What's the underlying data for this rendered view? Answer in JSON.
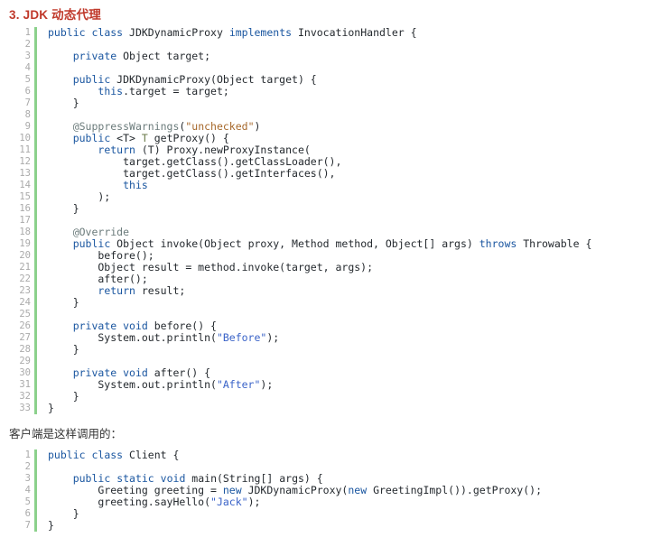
{
  "document": {
    "heading": "3. JDK 动态代理",
    "paragraph": "客户端是这样调用的：",
    "accent_colors": {
      "heading": "#c0392b",
      "gutter_rail": "#8cd18c",
      "line_number": "#aaaaaa",
      "keyword": "#1a56a0",
      "string": "#3a63c8",
      "string_alt": "#a6682b",
      "annotation": "#6b7b7b",
      "plain": "#24292e"
    }
  },
  "code_blocks": [
    {
      "name": "jdk-dynamic-proxy",
      "language": "java",
      "first_line": 1,
      "lines": [
        [
          {
            "t": "kw",
            "v": "public"
          },
          {
            "t": "pln",
            "v": " "
          },
          {
            "t": "kw",
            "v": "class"
          },
          {
            "t": "pln",
            "v": " JDKDynamicProxy "
          },
          {
            "t": "kw",
            "v": "implements"
          },
          {
            "t": "pln",
            "v": " InvocationHandler {"
          }
        ],
        [],
        [
          {
            "t": "pln",
            "v": "    "
          },
          {
            "t": "kw",
            "v": "private"
          },
          {
            "t": "pln",
            "v": " Object target;"
          }
        ],
        [],
        [
          {
            "t": "pln",
            "v": "    "
          },
          {
            "t": "kw",
            "v": "public"
          },
          {
            "t": "pln",
            "v": " JDKDynamicProxy(Object target) {"
          }
        ],
        [
          {
            "t": "pln",
            "v": "        "
          },
          {
            "t": "kw",
            "v": "this"
          },
          {
            "t": "pln",
            "v": ".target = target;"
          }
        ],
        [
          {
            "t": "pln",
            "v": "    }"
          }
        ],
        [],
        [
          {
            "t": "pln",
            "v": "    "
          },
          {
            "t": "ann",
            "v": "@SuppressWarnings"
          },
          {
            "t": "pln",
            "v": "("
          },
          {
            "t": "str-orange",
            "v": "\"unchecked\""
          },
          {
            "t": "pln",
            "v": ")"
          }
        ],
        [
          {
            "t": "pln",
            "v": "    "
          },
          {
            "t": "kw",
            "v": "public"
          },
          {
            "t": "pln",
            "v": " <T> "
          },
          {
            "t": "typ",
            "v": "T"
          },
          {
            "t": "pln",
            "v": " getProxy() {"
          }
        ],
        [
          {
            "t": "pln",
            "v": "        "
          },
          {
            "t": "kw",
            "v": "return"
          },
          {
            "t": "pln",
            "v": " (T) Proxy.newProxyInstance("
          }
        ],
        [
          {
            "t": "pln",
            "v": "            target.getClass().getClassLoader(),"
          }
        ],
        [
          {
            "t": "pln",
            "v": "            target.getClass().getInterfaces(),"
          }
        ],
        [
          {
            "t": "pln",
            "v": "            "
          },
          {
            "t": "kw",
            "v": "this"
          }
        ],
        [
          {
            "t": "pln",
            "v": "        );"
          }
        ],
        [
          {
            "t": "pln",
            "v": "    }"
          }
        ],
        [],
        [
          {
            "t": "pln",
            "v": "    "
          },
          {
            "t": "ann",
            "v": "@Override"
          }
        ],
        [
          {
            "t": "pln",
            "v": "    "
          },
          {
            "t": "kw",
            "v": "public"
          },
          {
            "t": "pln",
            "v": " Object invoke(Object proxy, Method method, Object[] args) "
          },
          {
            "t": "kw",
            "v": "throws"
          },
          {
            "t": "pln",
            "v": " Throwable {"
          }
        ],
        [
          {
            "t": "pln",
            "v": "        before();"
          }
        ],
        [
          {
            "t": "pln",
            "v": "        Object result = method.invoke(target, args);"
          }
        ],
        [
          {
            "t": "pln",
            "v": "        after();"
          }
        ],
        [
          {
            "t": "pln",
            "v": "        "
          },
          {
            "t": "kw",
            "v": "return"
          },
          {
            "t": "pln",
            "v": " result;"
          }
        ],
        [
          {
            "t": "pln",
            "v": "    }"
          }
        ],
        [],
        [
          {
            "t": "pln",
            "v": "    "
          },
          {
            "t": "kw",
            "v": "private"
          },
          {
            "t": "pln",
            "v": " "
          },
          {
            "t": "kw",
            "v": "void"
          },
          {
            "t": "pln",
            "v": " before() {"
          }
        ],
        [
          {
            "t": "pln",
            "v": "        System.out.println("
          },
          {
            "t": "str",
            "v": "\"Before\""
          },
          {
            "t": "pln",
            "v": ");"
          }
        ],
        [
          {
            "t": "pln",
            "v": "    }"
          }
        ],
        [],
        [
          {
            "t": "pln",
            "v": "    "
          },
          {
            "t": "kw",
            "v": "private"
          },
          {
            "t": "pln",
            "v": " "
          },
          {
            "t": "kw",
            "v": "void"
          },
          {
            "t": "pln",
            "v": " after() {"
          }
        ],
        [
          {
            "t": "pln",
            "v": "        System.out.println("
          },
          {
            "t": "str",
            "v": "\"After\""
          },
          {
            "t": "pln",
            "v": ");"
          }
        ],
        [
          {
            "t": "pln",
            "v": "    }"
          }
        ],
        [
          {
            "t": "pln",
            "v": "}"
          }
        ]
      ]
    },
    {
      "name": "client-usage",
      "language": "java",
      "first_line": 1,
      "lines": [
        [
          {
            "t": "kw",
            "v": "public"
          },
          {
            "t": "pln",
            "v": " "
          },
          {
            "t": "kw",
            "v": "class"
          },
          {
            "t": "pln",
            "v": " Client {"
          }
        ],
        [],
        [
          {
            "t": "pln",
            "v": "    "
          },
          {
            "t": "kw",
            "v": "public"
          },
          {
            "t": "pln",
            "v": " "
          },
          {
            "t": "kw",
            "v": "static"
          },
          {
            "t": "pln",
            "v": " "
          },
          {
            "t": "kw",
            "v": "void"
          },
          {
            "t": "pln",
            "v": " main(String[] args) {"
          }
        ],
        [
          {
            "t": "pln",
            "v": "        Greeting greeting = "
          },
          {
            "t": "kw",
            "v": "new"
          },
          {
            "t": "pln",
            "v": " JDKDynamicProxy("
          },
          {
            "t": "kw",
            "v": "new"
          },
          {
            "t": "pln",
            "v": " GreetingImpl()).getProxy();"
          }
        ],
        [
          {
            "t": "pln",
            "v": "        greeting.sayHello("
          },
          {
            "t": "str",
            "v": "\"Jack\""
          },
          {
            "t": "pln",
            "v": ");"
          }
        ],
        [
          {
            "t": "pln",
            "v": "    }"
          }
        ],
        [
          {
            "t": "pln",
            "v": "}"
          }
        ]
      ]
    }
  ]
}
